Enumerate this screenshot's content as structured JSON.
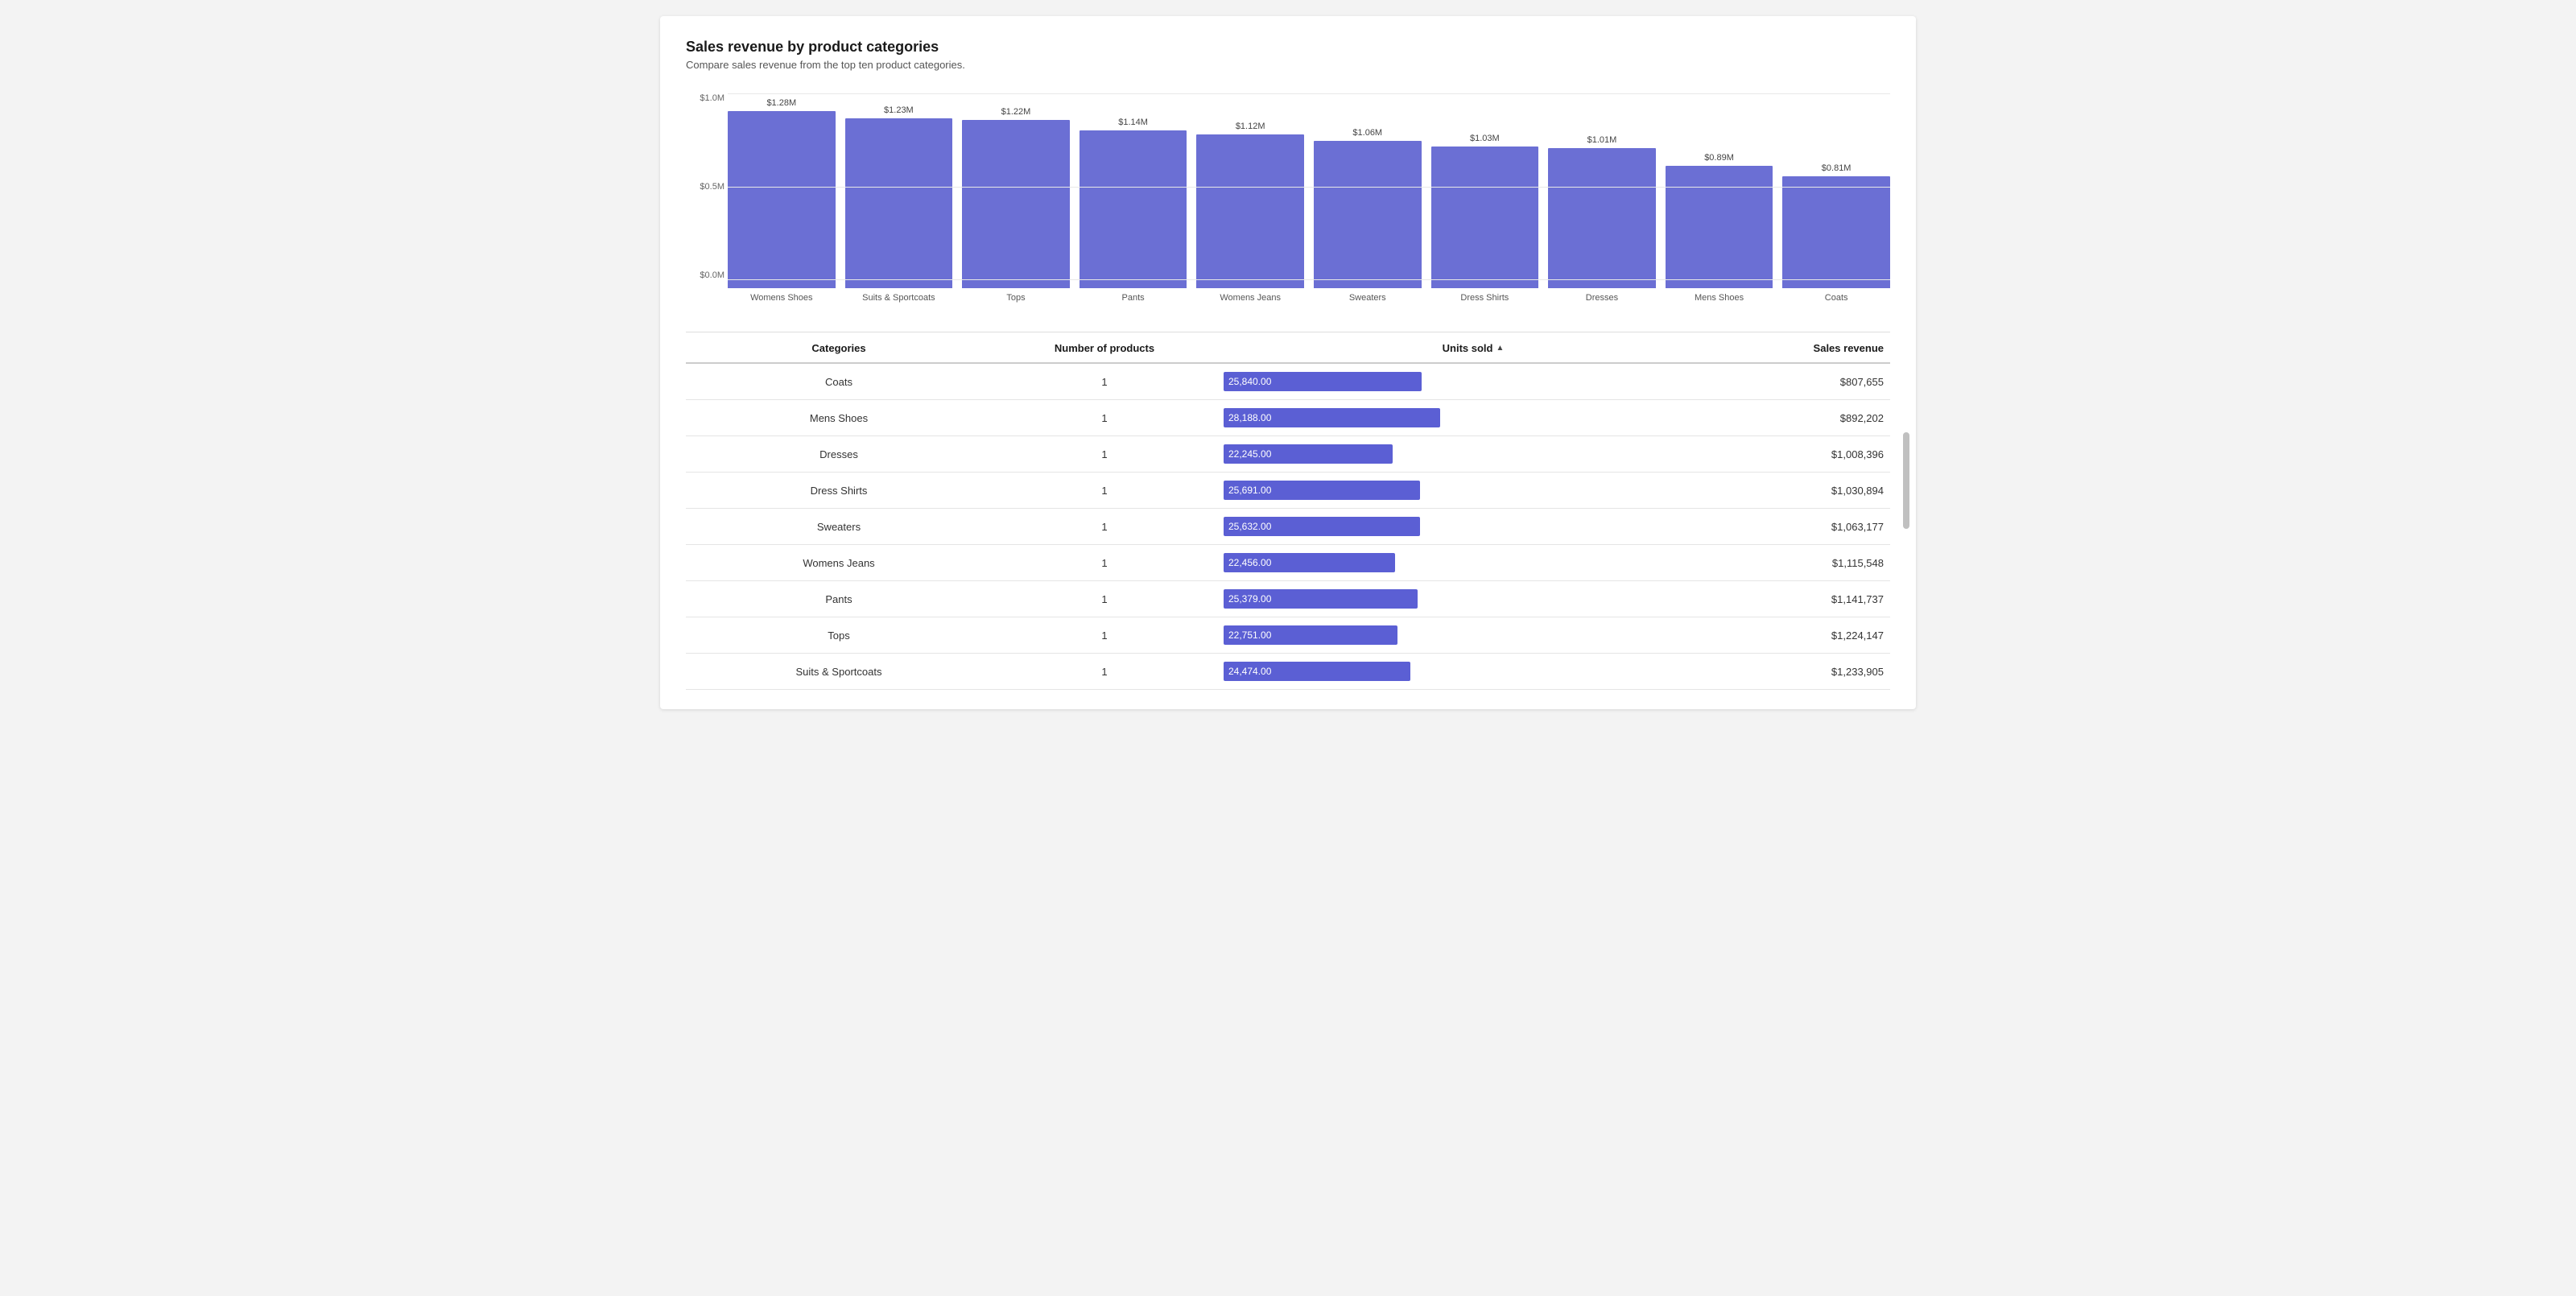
{
  "title": "Sales revenue by product categories",
  "subtitle": "Compare sales revenue from the top ten product categories.",
  "chart": {
    "y_labels": [
      "$1.0M",
      "$0.5M",
      "$0.0M"
    ],
    "bars": [
      {
        "category": "Womens Shoes",
        "value_label": "$1.28M",
        "height_pct": 100
      },
      {
        "category": "Suits & Sportcoats",
        "value_label": "$1.23M",
        "height_pct": 96
      },
      {
        "category": "Tops",
        "value_label": "$1.22M",
        "height_pct": 95
      },
      {
        "category": "Pants",
        "value_label": "$1.14M",
        "height_pct": 89
      },
      {
        "category": "Womens Jeans",
        "value_label": "$1.12M",
        "height_pct": 87
      },
      {
        "category": "Sweaters",
        "value_label": "$1.06M",
        "height_pct": 83
      },
      {
        "category": "Dress Shirts",
        "value_label": "$1.03M",
        "height_pct": 80
      },
      {
        "category": "Dresses",
        "value_label": "$1.01M",
        "height_pct": 79
      },
      {
        "category": "Mens Shoes",
        "value_label": "$0.89M",
        "height_pct": 69
      },
      {
        "category": "Coats",
        "value_label": "$0.81M",
        "height_pct": 63
      }
    ]
  },
  "table": {
    "headers": {
      "categories": "Categories",
      "products": "Number of products",
      "units": "Units sold",
      "revenue": "Sales revenue"
    },
    "rows": [
      {
        "category": "Coats",
        "products": "1",
        "units": "25,840.00",
        "units_pct": 88,
        "revenue": "$807,655"
      },
      {
        "category": "Mens Shoes",
        "products": "1",
        "units": "28,188.00",
        "units_pct": 96,
        "revenue": "$892,202"
      },
      {
        "category": "Dresses",
        "products": "1",
        "units": "22,245.00",
        "units_pct": 75,
        "revenue": "$1,008,396"
      },
      {
        "category": "Dress Shirts",
        "products": "1",
        "units": "25,691.00",
        "units_pct": 87,
        "revenue": "$1,030,894"
      },
      {
        "category": "Sweaters",
        "products": "1",
        "units": "25,632.00",
        "units_pct": 87,
        "revenue": "$1,063,177"
      },
      {
        "category": "Womens Jeans",
        "products": "1",
        "units": "22,456.00",
        "units_pct": 76,
        "revenue": "$1,115,548"
      },
      {
        "category": "Pants",
        "products": "1",
        "units": "25,379.00",
        "units_pct": 86,
        "revenue": "$1,141,737"
      },
      {
        "category": "Tops",
        "products": "1",
        "units": "22,751.00",
        "units_pct": 77,
        "revenue": "$1,224,147"
      },
      {
        "category": "Suits & Sportcoats",
        "products": "1",
        "units": "24,474.00",
        "units_pct": 83,
        "revenue": "$1,233,905"
      }
    ]
  }
}
